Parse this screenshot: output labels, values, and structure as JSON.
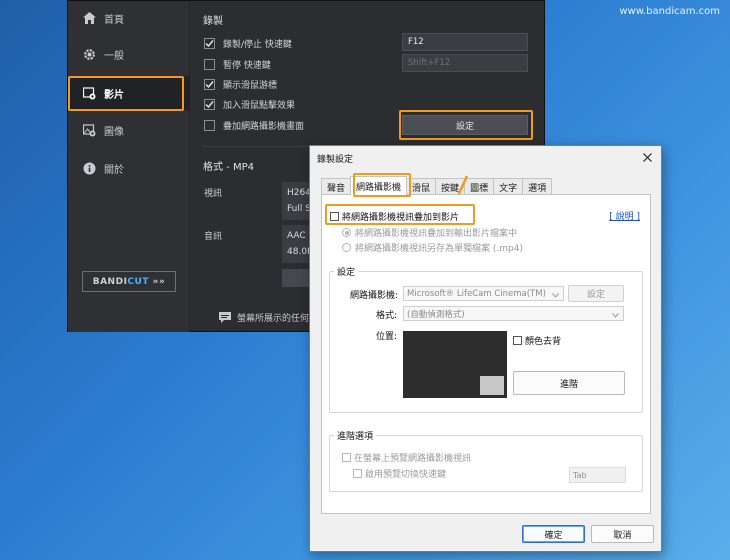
{
  "watermark": "www.bandicam.com",
  "colors": {
    "highlight": "#f39a1e",
    "link": "#1a4fd6",
    "bandicut_accent": "#4fb0ff"
  },
  "sidebar": {
    "items": [
      {
        "label": "首頁",
        "icon": "home-icon"
      },
      {
        "label": "一般",
        "icon": "gear-icon"
      },
      {
        "label": "影片",
        "icon": "video-settings-icon",
        "active": true
      },
      {
        "label": "圖像",
        "icon": "image-settings-icon"
      },
      {
        "label": "關於",
        "icon": "info-icon"
      }
    ],
    "bandicut": {
      "text_a": "BANDI",
      "text_b": "CUT",
      "arrows": "»»"
    }
  },
  "recording": {
    "title": "錄製",
    "options": [
      {
        "label": "錄製/停止 快速鍵",
        "checked": true
      },
      {
        "label": "暫停 快速鍵",
        "checked": false
      },
      {
        "label": "顯示滑鼠游標",
        "checked": true
      },
      {
        "label": "加入滑鼠點擊效果",
        "checked": true
      },
      {
        "label": "疊加網路攝影機畫面",
        "checked": false
      }
    ],
    "hotkey_record": "F12",
    "hotkey_pause": "Shift+F12",
    "settings_button": "設定"
  },
  "format": {
    "title": "格式 - MP4",
    "video_label": "視訊",
    "video_lines": [
      "H264",
      "Full S"
    ],
    "audio_label": "音訊",
    "audio_lines": [
      "AAC",
      "48.0K"
    ]
  },
  "footer_hint": "螢幕所展示的任何",
  "dialog": {
    "title": "錄製設定",
    "tabs": [
      "聲音",
      "網路攝影機",
      "滑鼠",
      "按鍵",
      "圖標",
      "文字",
      "選項"
    ],
    "active_tab": "網路攝影機",
    "overlay_checkbox": "將網路攝影機視訊疊加到影片",
    "help_link": "[ 說明 ]",
    "radio_options": [
      {
        "label": "將網路攝影機視訊疊加到輸出影片檔案中",
        "selected": true
      },
      {
        "label": "將網路攝影機視訊另存為單獨檔案 (.mp4)",
        "selected": false
      }
    ],
    "settings_group": {
      "title": "設定",
      "webcam_label": "網路攝影機:",
      "webcam_value": "Microsoft® LifeCam Cinema(TM)",
      "webcam_settings_button": "設定",
      "format_label": "格式:",
      "format_value": "(自動偵測格式)",
      "position_label": "位置:",
      "chroma_key": "顏色去背",
      "advanced_button": "進階"
    },
    "advanced_group": {
      "title": "進階選項",
      "preview_option": "在螢幕上預覽網路攝影機視訊",
      "hotkey_option": "啟用預覽切換快速鍵",
      "hotkey_value": "Tab"
    },
    "ok_button": "確定",
    "cancel_button": "取消"
  }
}
